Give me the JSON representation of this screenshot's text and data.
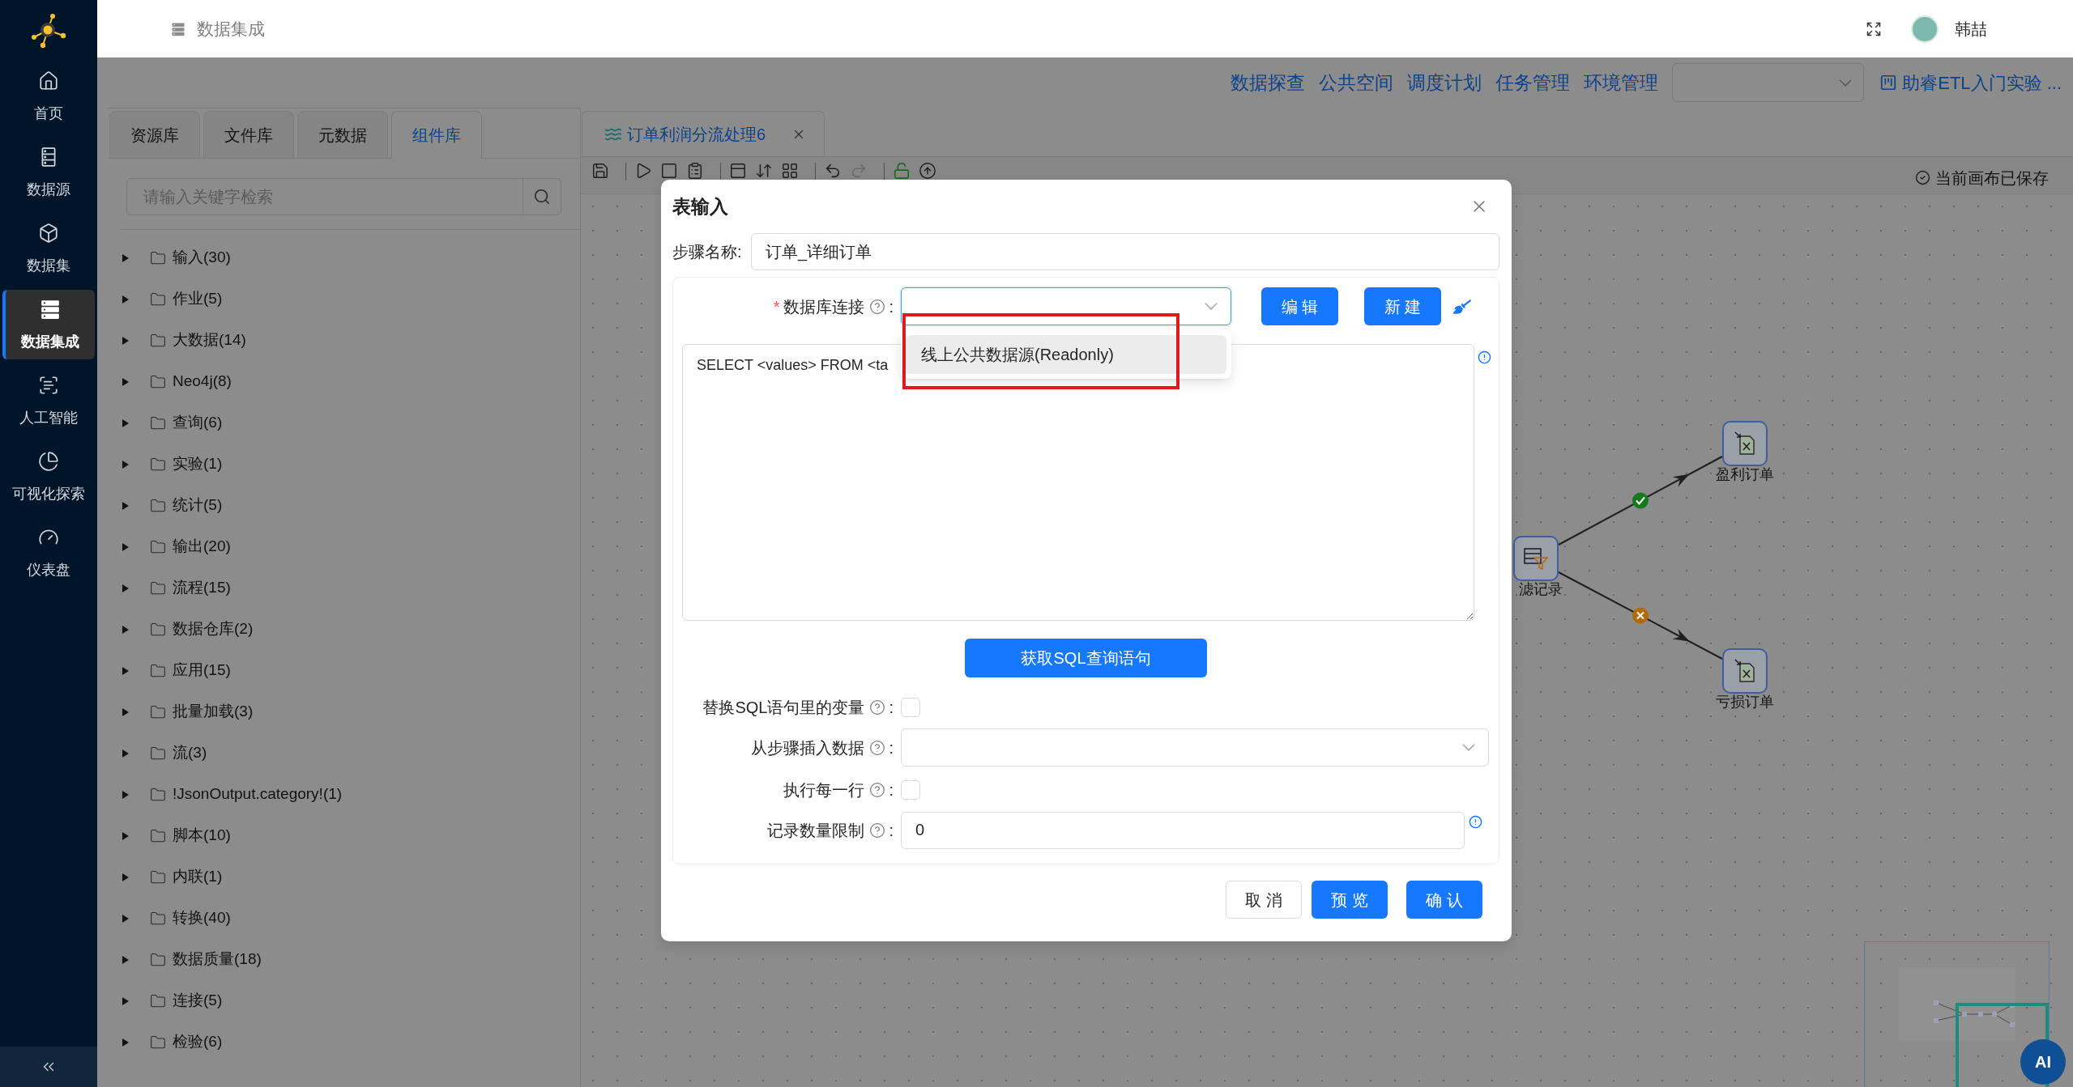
{
  "sidebar": {
    "items": [
      {
        "kind": "home",
        "label": "首页",
        "selected": false
      },
      {
        "kind": "datasource",
        "label": "数据源",
        "selected": false
      },
      {
        "kind": "dataset",
        "label": "数据集",
        "selected": false
      },
      {
        "kind": "integration",
        "label": "数据集成",
        "selected": true
      },
      {
        "kind": "ai",
        "label": "人工智能",
        "selected": false
      },
      {
        "kind": "visual",
        "label": "可视化探索",
        "selected": false
      },
      {
        "kind": "dashboard",
        "label": "仪表盘",
        "selected": false
      }
    ]
  },
  "header": {
    "title": "数据集成",
    "user_name": "韩喆"
  },
  "nav": {
    "links": [
      "数据探查",
      "公共空间",
      "调度计划",
      "任务管理",
      "环境管理"
    ],
    "project": "助睿ETL入门实验 ..."
  },
  "resource_panel": {
    "tabs": [
      {
        "label": "资源库",
        "selected": false
      },
      {
        "label": "文件库",
        "selected": false
      },
      {
        "label": "元数据",
        "selected": false
      },
      {
        "label": "组件库",
        "selected": true
      }
    ],
    "search": {
      "placeholder": "请输入关键字检索"
    },
    "tree": [
      {
        "label": "输入(30)",
        "expanded": false
      },
      {
        "label": "作业(5)",
        "expanded": false
      },
      {
        "label": "大数据(14)",
        "expanded": false
      },
      {
        "label": "Neo4j(8)",
        "expanded": false
      },
      {
        "label": "查询(6)",
        "expanded": false
      },
      {
        "label": "实验(1)",
        "expanded": false
      },
      {
        "label": "统计(5)",
        "expanded": false
      },
      {
        "label": "输出(20)",
        "expanded": false
      },
      {
        "label": "流程(15)",
        "expanded": false
      },
      {
        "label": "数据仓库(2)",
        "expanded": false
      },
      {
        "label": "应用(15)",
        "expanded": false
      },
      {
        "label": "批量加载(3)",
        "expanded": false
      },
      {
        "label": "流(3)",
        "expanded": false
      },
      {
        "label": "!JsonOutput.category!(1)",
        "expanded": false
      },
      {
        "label": "脚本(10)",
        "expanded": false
      },
      {
        "label": "内联(1)",
        "expanded": false
      },
      {
        "label": "转换(40)",
        "expanded": false
      },
      {
        "label": "数据质量(18)",
        "expanded": false
      },
      {
        "label": "连接(5)",
        "expanded": false
      },
      {
        "label": "检验(6)",
        "expanded": false
      }
    ]
  },
  "editor": {
    "tabs": [
      {
        "label": "订单利润分流处理6",
        "selected": true
      }
    ],
    "save_status": "当前画布已保存",
    "nodes": [
      {
        "kind": "filter",
        "label": "滤记录"
      },
      {
        "kind": "excel-output",
        "label": "盈利订单"
      },
      {
        "kind": "excel-output",
        "label": "亏损订单"
      }
    ],
    "hops": [
      {
        "kind": "pass"
      },
      {
        "kind": "fail"
      }
    ]
  },
  "dialog": {
    "title": "表输入",
    "step_name": {
      "label": "步骤名称",
      "colon": ":",
      "value": "订单_详细订单"
    },
    "connection": {
      "required_mark": "*",
      "label": "数据库连接",
      "colon": ":",
      "focused": true,
      "buttons": [
        "编 辑",
        "新 建"
      ],
      "dropdown": {
        "open": true,
        "options": [
          {
            "label": "线上公共数据源(Readonly)",
            "active": true
          }
        ]
      }
    },
    "sql": {
      "value": "SELECT <values> FROM <ta"
    },
    "get_sql_button": "获取SQL查询语句",
    "fields": [
      {
        "kind": "checkbox",
        "label": "替换SQL语句里的变量",
        "colon": ":",
        "checked": false
      },
      {
        "kind": "select",
        "label": "从步骤插入数据",
        "colon": ":"
      },
      {
        "kind": "checkbox",
        "label": "执行每一行",
        "colon": ":",
        "checked": false
      },
      {
        "kind": "number",
        "label": "记录数量限制",
        "colon": ":",
        "value": "0"
      }
    ],
    "footer_buttons": [
      {
        "kind": "default",
        "label": "取 消"
      },
      {
        "kind": "primary",
        "label": "预 览"
      },
      {
        "kind": "primary",
        "label": "确 认"
      }
    ]
  },
  "assistant_button": {
    "label": "AI"
  }
}
